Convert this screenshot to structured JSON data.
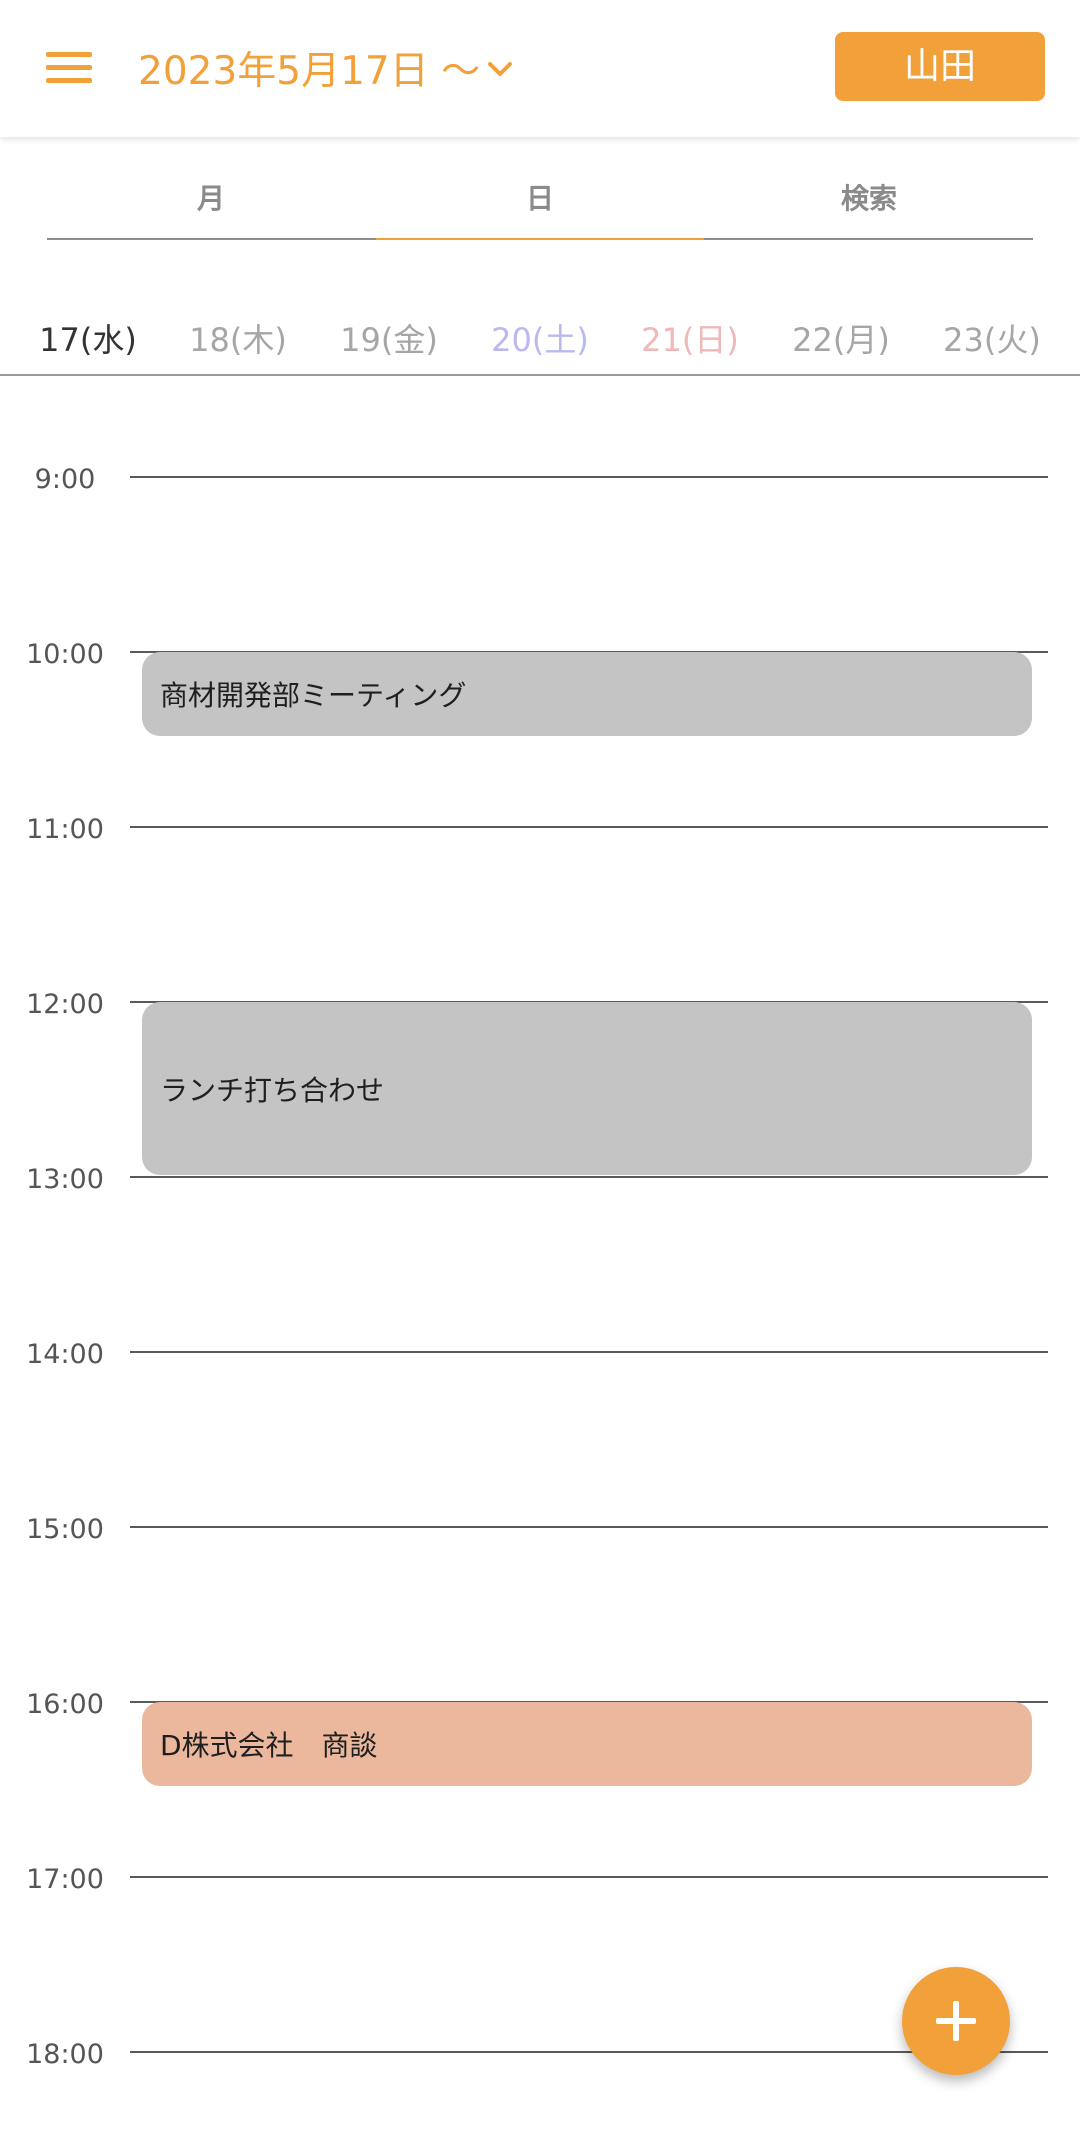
{
  "header": {
    "date_title": "2023年5月17日 〜",
    "user_button_label": "山田",
    "accent_color": "#f2a03a",
    "icons": [
      "hamburger-menu-icon",
      "chevron-down-icon"
    ]
  },
  "tabs": [
    {
      "label": "月",
      "active": false
    },
    {
      "label": "日",
      "active": true
    },
    {
      "label": "検索",
      "active": false
    }
  ],
  "days": [
    {
      "label": "17(水)",
      "selected": true,
      "color": "#333333"
    },
    {
      "label": "18(木)",
      "selected": false,
      "color": "#a6a6a6"
    },
    {
      "label": "19(金)",
      "selected": false,
      "color": "#a6a6a6"
    },
    {
      "label": "20(土)",
      "selected": false,
      "color": "#b9b9f0"
    },
    {
      "label": "21(日)",
      "selected": false,
      "color": "#f0b8b8"
    },
    {
      "label": "22(月)",
      "selected": false,
      "color": "#a6a6a6"
    },
    {
      "label": "23(火)",
      "selected": false,
      "color": "#a6a6a6"
    }
  ],
  "hours": [
    "9:00",
    "10:00",
    "11:00",
    "12:00",
    "13:00",
    "14:00",
    "15:00",
    "16:00",
    "17:00",
    "18:00"
  ],
  "events": [
    {
      "title": "商材開発部ミーティング",
      "start": "10:00",
      "end": "10:30",
      "color": "#c4c4c4"
    },
    {
      "title": "ランチ打ち合わせ",
      "start": "12:00",
      "end": "13:00",
      "color": "#c4c4c4"
    },
    {
      "title": "D株式会社　商談",
      "start": "16:00",
      "end": "16:30",
      "color": "#ebb89e"
    }
  ],
  "fab": {
    "icon": "plus-icon"
  }
}
